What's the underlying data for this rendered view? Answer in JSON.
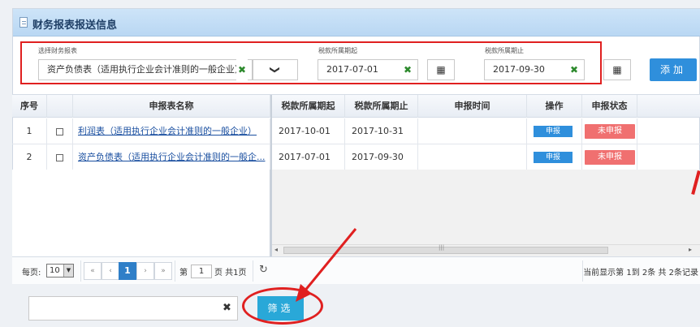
{
  "panel": {
    "title": "财务报表报送信息"
  },
  "filters": {
    "report_label": "选择财务报表",
    "report_value": "资产负债表（适用执行企业会计准则的一般企业）",
    "start_label": "税款所属期起",
    "start_value": "2017-07-01",
    "end_label": "税款所属期止",
    "end_value": "2017-09-30",
    "add_label": "添加",
    "clear_glyph": "✖",
    "dropdown_glyph": "❯",
    "calendar_glyph": "▦"
  },
  "table": {
    "headers": [
      "序号",
      "",
      "申报表名称",
      "税款所属期起",
      "税款所属期止",
      "申报时间",
      "操作",
      "申报状态"
    ],
    "rows": [
      {
        "no": "1",
        "name": "利润表（适用执行企业会计准则的一般企业）",
        "start": "2017-10-01",
        "end": "2017-10-31",
        "time": "",
        "action": "申报",
        "status": "未申报"
      },
      {
        "no": "2",
        "name": "资产负债表（适用执行企业会计准则的一般企...",
        "start": "2017-07-01",
        "end": "2017-09-30",
        "time": "",
        "action": "申报",
        "status": "未申报"
      }
    ]
  },
  "pager": {
    "per_page_label": "每页:",
    "per_page_value": "10",
    "first": "«",
    "prev": "‹",
    "current_page": "1",
    "next": "›",
    "last": "»",
    "page_prefix": "第",
    "page_input": "1",
    "page_suffix": "页 共1页",
    "refresh": "↻",
    "info": "当前显示第 1到 2条 共 2条记录"
  },
  "bottom": {
    "input_value": "",
    "clear_glyph": "✖",
    "filter_label": "筛选"
  },
  "colors": {
    "accent": "#2f8fdc",
    "alert": "#e02020",
    "status_bad": "#f07070"
  }
}
